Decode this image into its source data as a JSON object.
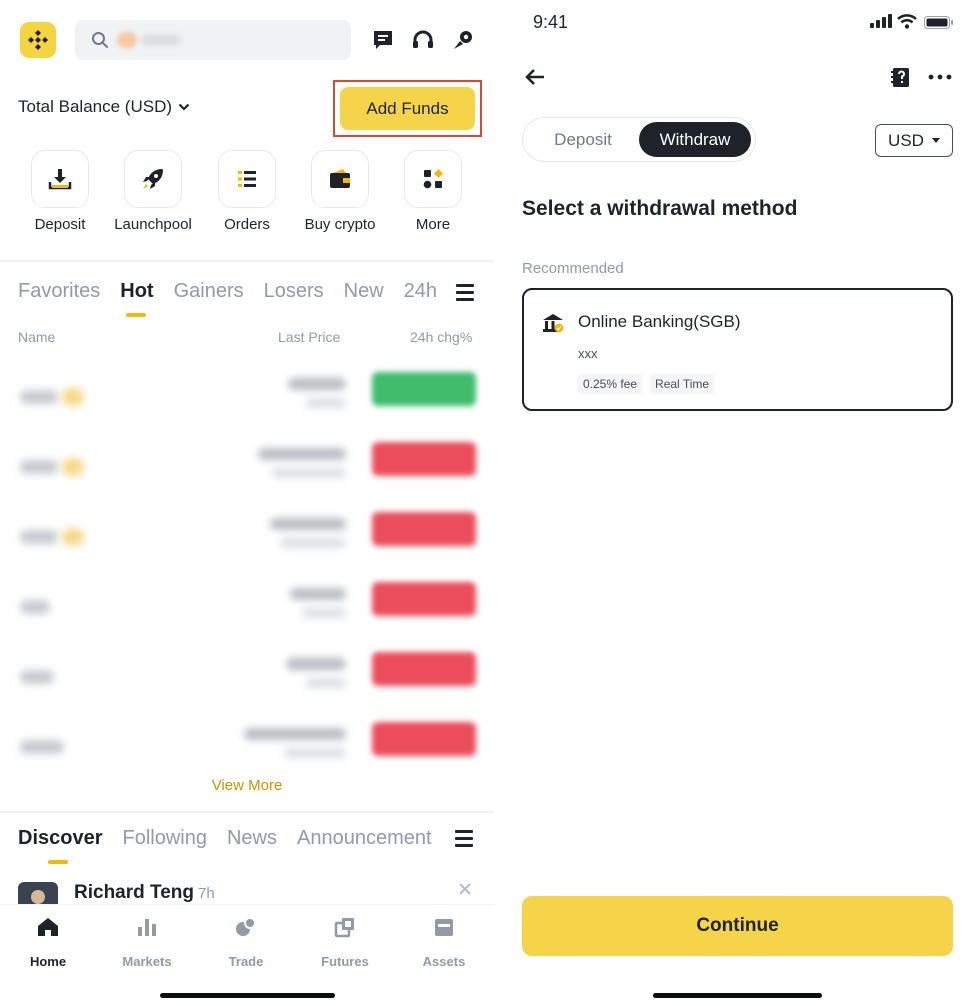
{
  "home": {
    "top_icons": [
      "logo-icon",
      "search-icon",
      "message-icon",
      "headset-icon",
      "pay-icon"
    ],
    "balance_label": "Total Balance (USD)",
    "add_funds_label": "Add Funds",
    "quick_actions": [
      {
        "label": "Deposit",
        "icon": "deposit-icon"
      },
      {
        "label": "Launchpool",
        "icon": "rocket-icon"
      },
      {
        "label": "Orders",
        "icon": "list-icon"
      },
      {
        "label": "Buy crypto",
        "icon": "wallet-icon"
      },
      {
        "label": "More",
        "icon": "grid-icon"
      }
    ],
    "market_tabs": [
      "Favorites",
      "Hot",
      "Gainers",
      "Losers",
      "New",
      "24h"
    ],
    "market_active_tab": "Hot",
    "columns": {
      "name": "Name",
      "last_price": "Last Price",
      "change": "24h chg%"
    },
    "market_rows": [
      {
        "direction": "up",
        "color": "#3fbc6c"
      },
      {
        "direction": "down",
        "color": "#eb4d5c"
      },
      {
        "direction": "down",
        "color": "#eb4d5c"
      },
      {
        "direction": "down",
        "color": "#eb4d5c"
      },
      {
        "direction": "down",
        "color": "#eb4d5c"
      },
      {
        "direction": "down",
        "color": "#eb4d5c"
      }
    ],
    "view_more_label": "View More",
    "discover_tabs": [
      "Discover",
      "Following",
      "News",
      "Announcement"
    ],
    "discover_active_tab": "Discover",
    "post": {
      "author": "Richard Teng",
      "time": "7h"
    },
    "nav": [
      {
        "label": "Home",
        "icon": "home-icon",
        "active": true
      },
      {
        "label": "Markets",
        "icon": "bar-chart-icon",
        "active": false
      },
      {
        "label": "Trade",
        "icon": "trade-icon",
        "active": false
      },
      {
        "label": "Futures",
        "icon": "futures-icon",
        "active": false
      },
      {
        "label": "Assets",
        "icon": "wallet-icon",
        "active": false
      }
    ]
  },
  "withdraw": {
    "status_time": "9:41",
    "segments": [
      "Deposit",
      "Withdraw"
    ],
    "active_segment": "Withdraw",
    "currency": "USD",
    "heading": "Select a withdrawal method",
    "recommended_label": "Recommended",
    "method": {
      "name": "Online Banking(SGB)",
      "subtitle": "xxx",
      "tags": [
        "0.25% fee",
        "Real Time"
      ]
    },
    "continue_label": "Continue"
  },
  "colors": {
    "brand": "#f5d44a",
    "accent_gold": "#f0b90b",
    "up": "#3fbc6c",
    "down": "#eb4d5c",
    "highlight_box": "#d44a35",
    "text": "#1e2329"
  }
}
